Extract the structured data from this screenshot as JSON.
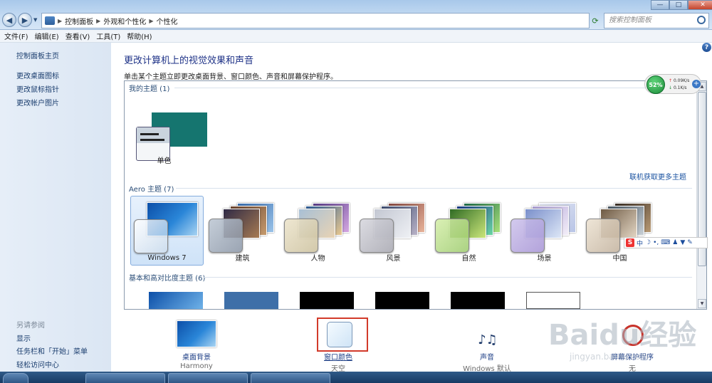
{
  "breadcrumbs": [
    "控制面板",
    "外观和个性化",
    "个性化"
  ],
  "search": {
    "placeholder": "搜索控制面板"
  },
  "window_controls": {
    "minimize": "—",
    "maximize": "□",
    "close": "✕"
  },
  "menu": [
    "文件(F)",
    "编辑(E)",
    "查看(V)",
    "工具(T)",
    "帮助(H)"
  ],
  "sidebar": {
    "items": [
      {
        "label": "控制面板主页"
      },
      {
        "label": "更改桌面图标"
      },
      {
        "label": "更改鼠标指针"
      },
      {
        "label": "更改帐户图片"
      }
    ],
    "see_also_title": "另请参阅",
    "see_also": [
      {
        "label": "显示"
      },
      {
        "label": "任务栏和「开始」菜单"
      },
      {
        "label": "轻松访问中心"
      }
    ]
  },
  "main": {
    "title": "更改计算机上的视觉效果和声音",
    "subtitle": "单击某个主题立即更改桌面背景、窗口颜色、声音和屏幕保护程序。",
    "my_themes_label": "我的主题 (1)",
    "my_themes": [
      {
        "label": "单色"
      }
    ],
    "online_link": "联机获取更多主题",
    "aero_label": "Aero 主题 (7)",
    "aero_themes": [
      {
        "label": "Windows 7",
        "selected": true
      },
      {
        "label": "建筑"
      },
      {
        "label": "人物"
      },
      {
        "label": "风景"
      },
      {
        "label": "自然"
      },
      {
        "label": "场景"
      },
      {
        "label": "中国"
      }
    ],
    "basic_label": "基本和高对比度主题 (6)"
  },
  "controls": [
    {
      "label": "桌面背景",
      "sub": "Harmony"
    },
    {
      "label": "窗口颜色",
      "sub": "天空"
    },
    {
      "label": "声音",
      "sub": "Windows 默认"
    },
    {
      "label": "屏幕保护程序",
      "sub": "无"
    }
  ],
  "netmeter": {
    "percent": "52%",
    "up": "0.09K/s",
    "down": "0.1K/s"
  },
  "ime": {
    "mode": "中"
  },
  "watermark": {
    "main": "Baidu经验",
    "sub": "jingyan.baidu.com"
  },
  "colors": {
    "link": "#1e3287",
    "solid_theme": "#15756f",
    "highlight": "#d23a2a"
  }
}
